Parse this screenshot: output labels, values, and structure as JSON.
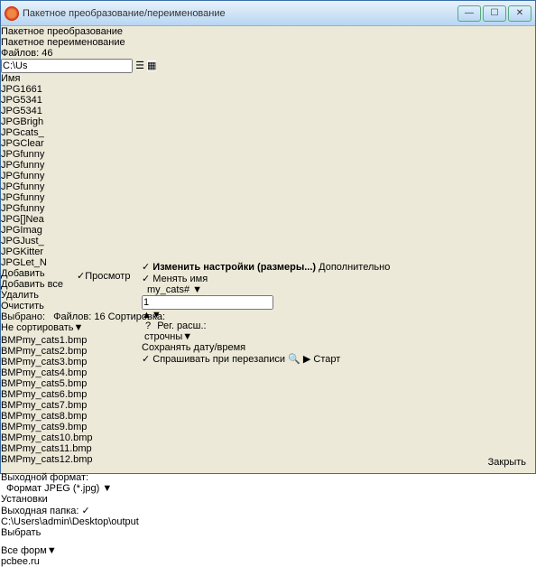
{
  "window": {
    "title": "Пакетное преобразование/переименование"
  },
  "tabs": {
    "convert": "Пакетное преобразование",
    "rename": "Пакетное переименование"
  },
  "filecount": "Файлов: 46",
  "pathvalue": "C:\\Us",
  "tree": {
    "header": "Имя",
    "items": [
      "1661",
      "5341",
      "5341",
      "Brigh",
      "cats_",
      "Clear",
      "funny",
      "funny",
      "funny",
      "funny",
      "funny",
      "funny",
      "[]Nea",
      "Imag",
      "Just_",
      "Kitter",
      "Let_N"
    ]
  },
  "buttons": {
    "add": "Добавить",
    "addall": "Добавить все",
    "remove": "Удалить",
    "clear": "Очистить"
  },
  "listheader": {
    "selected": "Выбрано:",
    "filecount": "Файлов: 16",
    "sort": "Сортировка:"
  },
  "sortcombo": "Не сортировать",
  "files": [
    "my_cats1.bmp",
    "my_cats2.bmp",
    "my_cats3.bmp",
    "my_cats4.bmp",
    "my_cats5.bmp",
    "my_cats6.bmp",
    "my_cats7.bmp",
    "my_cats8.bmp",
    "my_cats9.bmp",
    "my_cats10.bmp",
    "my_cats11.bmp",
    "my_cats12.bmp"
  ],
  "outformat": {
    "label": "Выходной формат:",
    "value": "Формат JPEG (*.jpg)",
    "btn": "Установки"
  },
  "outfolder": {
    "label": "Выходная папка:",
    "value": "C:\\Users\\admin\\Desktop\\output",
    "btn": "Выбрать"
  },
  "preview": "Просмотр",
  "settings": {
    "change": "Изменить настройки (размеры...)",
    "advanced": "Дополнительно",
    "rename": "Менять имя",
    "pattern": "my_cats#",
    "spinval": "1",
    "qbtn": "?",
    "extcase": "Рег. расш.:",
    "extcaseval": "строчны",
    "keepdate": "Сохранять дату/время",
    "askover": "Спрашивать при перезаписи"
  },
  "actions": {
    "start": "Старт",
    "close": "Закрыть"
  },
  "bottomcombo": "Все форм",
  "watermark": "pcbee.ru"
}
